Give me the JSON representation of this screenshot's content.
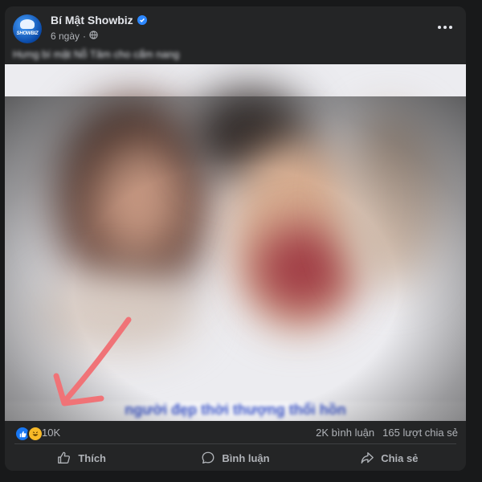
{
  "post": {
    "page_name": "Bí Mật Showbiz",
    "avatar_text": "BÍ MẬT SHOWBIZ",
    "time": "6 ngày",
    "privacy_icon": "globe-icon",
    "caption": "H​ưng bí m​ật N​ỗ Tâm cho cẩm n​ang",
    "image_bottom_text": "n​gười đ​ẹp thời ​thượng ​thổi ​hồn"
  },
  "stats": {
    "reaction_icons": [
      "like-icon",
      "haha-icon"
    ],
    "reaction_count": "10K",
    "comments": "2K bình luận",
    "shares": "165 lượt chia sẻ"
  },
  "actions": {
    "like": "Thích",
    "comment": "Bình luận",
    "share": "Chia sẻ"
  },
  "colors": {
    "background": "#18191a",
    "card": "#242526",
    "primary_text": "#e4e6eb",
    "secondary_text": "#b0b3b8",
    "verified": "#2d88ff",
    "annotation_arrow": "#f07377"
  }
}
